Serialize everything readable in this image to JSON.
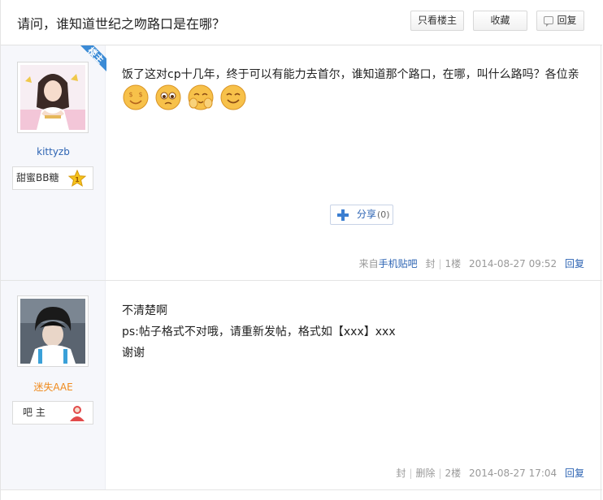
{
  "thread": {
    "title": "请问，谁知道世纪之吻路口是在哪？",
    "buttons": {
      "only_op": "只看楼主",
      "favorite": "收藏",
      "reply": "回复"
    }
  },
  "posts": [
    {
      "username": "kittyzb",
      "op_badge": "楼主",
      "level_title": "甜蜜BB糖",
      "level_num": "1",
      "text": "饭了这对cp十几年，终于可以有能力去首尔，谁知道那个路口，在哪，叫什么路吗？各位亲",
      "emoticons": [
        "money-eyes-emoticon",
        "teary-emoticon",
        "shy-hands-emoticon",
        "smile-emoticon"
      ],
      "share": {
        "label": "分享",
        "count": "(0)"
      },
      "tail": {
        "source_prefix": "来自",
        "source_link": "手机贴吧",
        "seal": "封",
        "floor": "1楼",
        "time": "2014-08-27 09:52",
        "reply": "回复"
      }
    },
    {
      "username": "迷失AAE",
      "level_title": "吧 主",
      "lines": [
        "不清楚啊",
        "ps:帖子格式不对哦，请重新发帖，格式如【xxx】xxx",
        "谢谢"
      ],
      "tail": {
        "seal": "封",
        "delete": "删除",
        "floor": "2楼",
        "time": "2014-08-27 17:04",
        "reply": "回复"
      }
    }
  ],
  "colors": {
    "link": "#2d64b3",
    "mod_name": "#f08a1c",
    "sidebar": "#f6f7fb"
  }
}
